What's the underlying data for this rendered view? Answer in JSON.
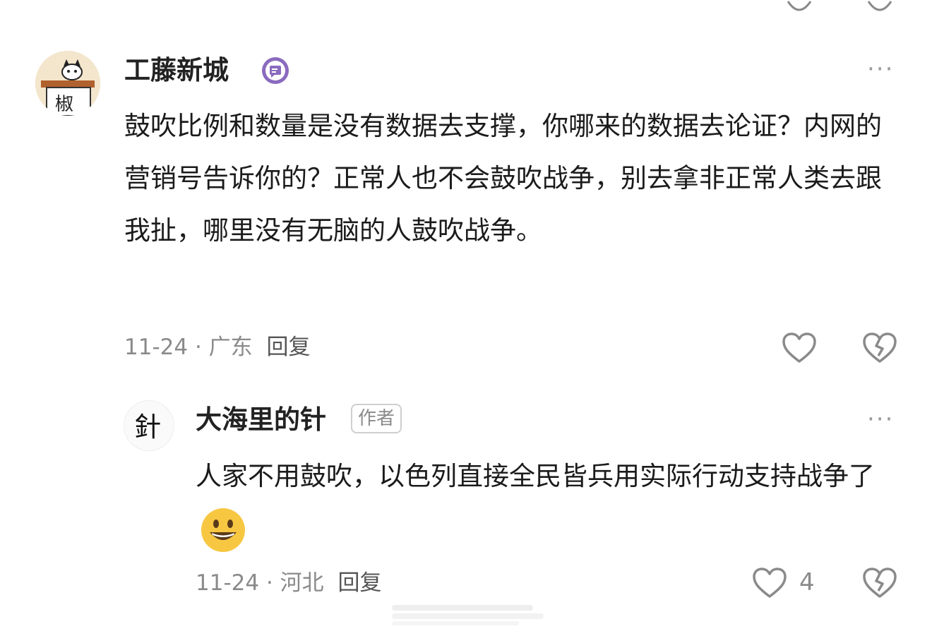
{
  "comments": [
    {
      "username": "工藤新城",
      "badge_icon": "message-badge-icon",
      "text": "鼓吹比例和数量是没有数据去支撑，你哪来的数据去论证？内网的营销号告诉你的？正常人也不会鼓吹战争，别去拿非正常人类去跟我扯，哪里没有无脑的人鼓吹战争。",
      "date": "11-24",
      "location": "广东",
      "reply_label": "回复",
      "more_label": "···"
    },
    {
      "username": "大海里的针",
      "author_tag": "作者",
      "text": "人家不用鼓吹，以色列直接全民皆兵用实际行动支持战争了",
      "emoji_icon": "grinning-face-emoji-icon",
      "date": "11-24",
      "location": "河北",
      "reply_label": "回复",
      "like_count": "4",
      "more_label": "···"
    }
  ],
  "separator": "·",
  "colors": {
    "accent_badge": "#7b5ea7",
    "text": "#1b1b1b",
    "meta": "#8a8a8a"
  }
}
